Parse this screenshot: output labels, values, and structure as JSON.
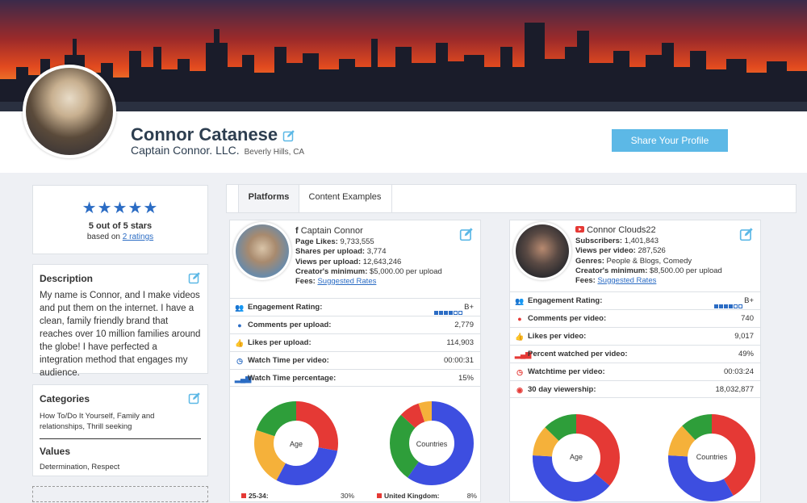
{
  "profile": {
    "name": "Connor Catanese",
    "company": "Captain Connor. LLC.",
    "location": "Beverly Hills, CA",
    "share_label": "Share Your Profile"
  },
  "rating": {
    "stars": "★★★★★",
    "summary": "5 out of 5 stars",
    "based_on": "based on ",
    "ratings_link": "2 ratings",
    "value": 5
  },
  "description": {
    "title": "Description",
    "text": "My name is Connor, and I make videos and put them on the internet. I have a clean, family friendly brand that reaches over 10 million families around the globe! I have perfected a integration method that engages my audience."
  },
  "categories": {
    "title": "Categories",
    "text": "How To/Do It Yourself, Family and relationships, Thrill seeking",
    "values_title": "Values",
    "values_text": "Determination, Respect"
  },
  "tabs": [
    {
      "label": "Platforms",
      "active": true
    },
    {
      "label": "Content Examples",
      "active": false
    }
  ],
  "facebook": {
    "platform_icon": "f",
    "handle": "Captain Connor",
    "info": [
      {
        "label": "Page Likes:",
        "value": " 9,733,555"
      },
      {
        "label": "Shares per upload:",
        "value": " 3,774"
      },
      {
        "label": "Views per upload:",
        "value": " 12,643,246"
      },
      {
        "label": "Creator's minimum:",
        "value": " $5,000.00 per upload"
      }
    ],
    "fees_label": "Fees:",
    "fees_link": "Suggested Rates",
    "engagement_label": "Engagement Rating:",
    "engagement_grade": "B+",
    "engagement_level": 4,
    "stats": [
      {
        "icon": "speech-bubble-icon",
        "glyph": "●",
        "label": "Comments per upload:",
        "value": "2,779"
      },
      {
        "icon": "thumbs-up-icon",
        "glyph": "✋",
        "label": "Likes per upload:",
        "value": "114,903"
      },
      {
        "icon": "clock-icon",
        "glyph": "◷",
        "label": "Watch Time per video:",
        "value": "00:00:31"
      },
      {
        "icon": "signal-bars-icon",
        "glyph": "▁▃▅",
        "label": "Watch Time percentage:",
        "value": "15%"
      }
    ],
    "donut_age_label": "Age",
    "donut_countries_label": "Countries",
    "legend_left_label": "25-34:",
    "legend_left_value": "30%",
    "legend_right_label": "United Kingdom:",
    "legend_right_value": "8%"
  },
  "youtube": {
    "handle": "Connor Clouds22",
    "info": [
      {
        "label": "Subscribers:",
        "value": " 1,401,843"
      },
      {
        "label": "Views per video:",
        "value": " 287,526"
      },
      {
        "label": "Genres:",
        "value": " People & Blogs, Comedy"
      },
      {
        "label": "Creator's minimum:",
        "value": " $8,500.00 per upload"
      }
    ],
    "fees_label": "Fees:",
    "fees_link": "Suggested Rates",
    "engagement_label": "Engagement Rating:",
    "engagement_grade": "B+",
    "engagement_level": 4,
    "stats": [
      {
        "icon": "speech-bubble-icon",
        "glyph": "●",
        "label": "Comments per video:",
        "value": "740"
      },
      {
        "icon": "thumbs-up-icon",
        "glyph": "✋",
        "label": "Likes per video:",
        "value": "9,017"
      },
      {
        "icon": "signal-bars-icon",
        "glyph": "▁▃▅",
        "label": "Percent watched per video:",
        "value": "49%"
      },
      {
        "icon": "clock-icon",
        "glyph": "◷",
        "label": "Watchtime per video:",
        "value": "00:03:24"
      },
      {
        "icon": "eye-icon",
        "glyph": "◉",
        "label": "30 day viewership:",
        "value": "18,032,877"
      }
    ],
    "donut_age_label": "Age",
    "donut_countries_label": "Countries"
  },
  "colors": {
    "accent": "#2b6cc4",
    "share_button": "#5cb8e6",
    "donut_red": "#e53935",
    "donut_blue": "#3d4ee0",
    "donut_orange": "#f5b13a",
    "donut_green": "#2e9e3a"
  }
}
